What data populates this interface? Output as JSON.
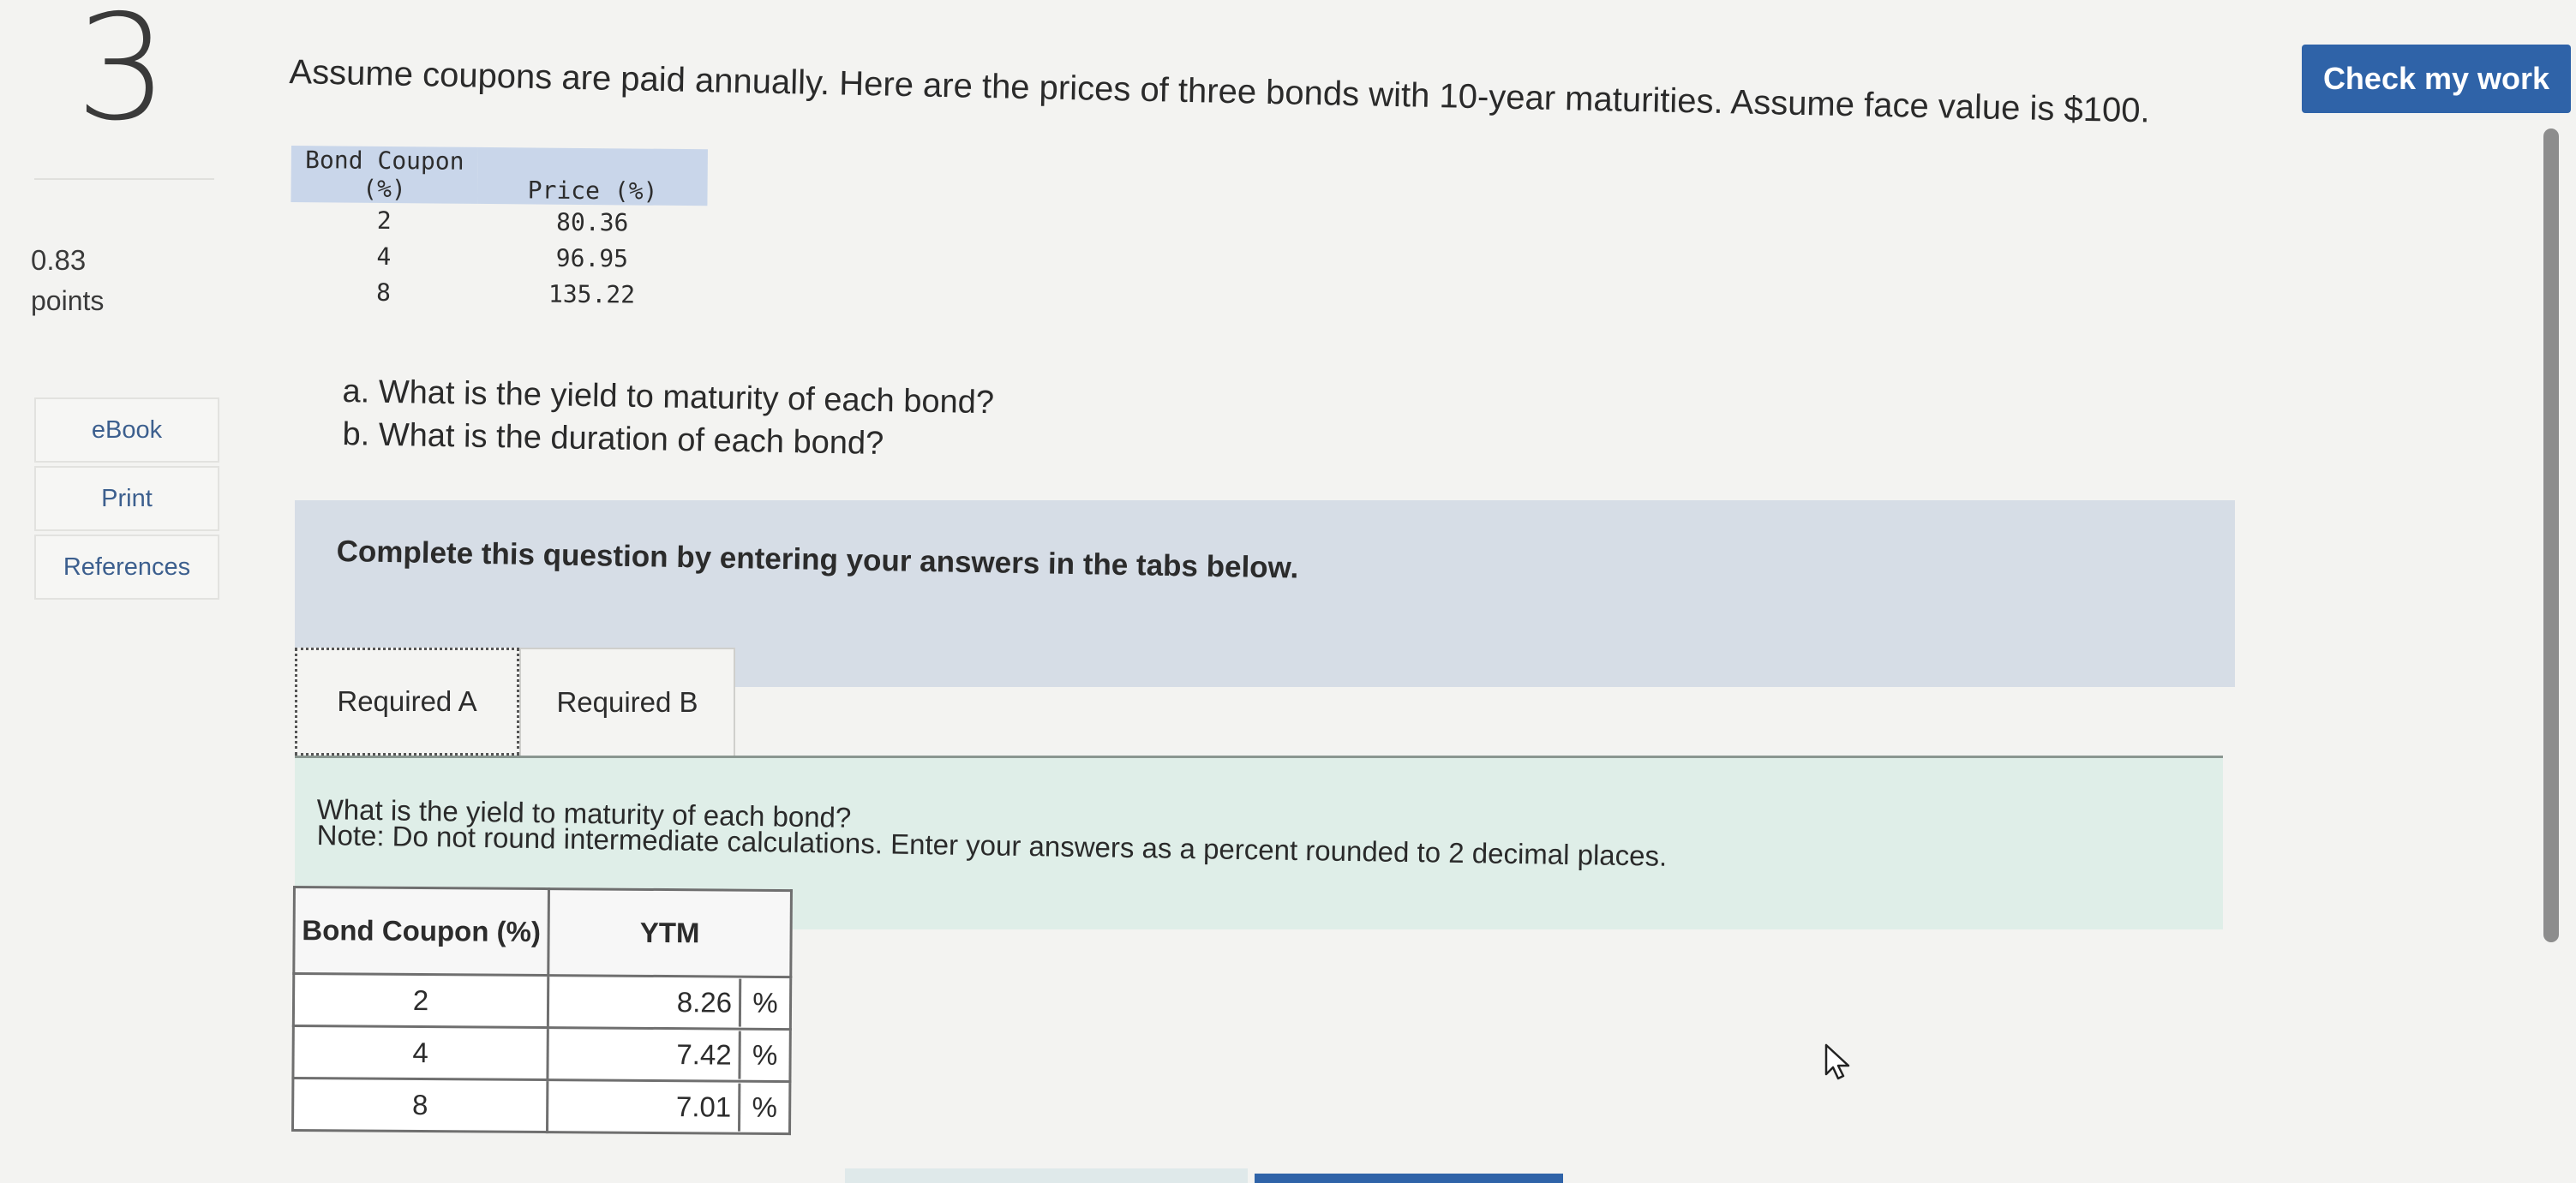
{
  "question_number": "3",
  "points": {
    "value": "0.83",
    "label": "points"
  },
  "side_buttons": {
    "ebook": "eBook",
    "print": "Print",
    "references": "References"
  },
  "check_button": "Check my work",
  "question_text": "Assume coupons are paid annually. Here are the prices of three bonds with 10-year maturities. Assume face value is $100.",
  "bond_table": {
    "headers": [
      "Bond Coupon (%)",
      "Price (%)"
    ],
    "rows": [
      {
        "coupon": "2",
        "price": "80.36"
      },
      {
        "coupon": "4",
        "price": "96.95"
      },
      {
        "coupon": "8",
        "price": "135.22"
      }
    ]
  },
  "sub_questions": {
    "a": "a. What is the yield to maturity of each bond?",
    "b": "b. What is the duration of each bond?"
  },
  "complete_instruction": "Complete this question by entering your answers in the tabs below.",
  "tabs": [
    {
      "label": "Required A"
    },
    {
      "label": "Required B"
    }
  ],
  "panel": {
    "question": "What is the yield to maturity of each bond?",
    "note": "Note: Do not round intermediate calculations. Enter your answers as a percent rounded to 2 decimal places."
  },
  "ytm_table": {
    "headers": [
      "Bond Coupon (%)",
      "YTM"
    ],
    "rows": [
      {
        "coupon": "2",
        "ytm": "8.26",
        "unit": "%"
      },
      {
        "coupon": "4",
        "ytm": "7.42",
        "unit": "%"
      },
      {
        "coupon": "8",
        "ytm": "7.01",
        "unit": "%"
      }
    ]
  },
  "colors": {
    "accent": "#2f63a8",
    "table_header": "#c9d6ea",
    "panel_green": "#dfeee8"
  }
}
